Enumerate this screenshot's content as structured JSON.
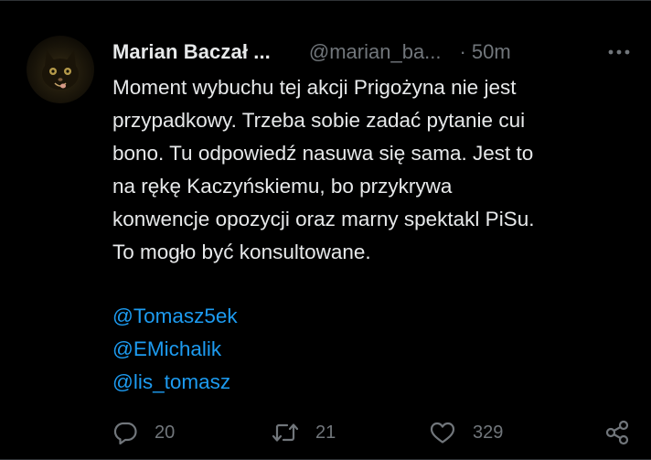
{
  "tweet": {
    "author": {
      "display_name": "Marian Baczał ...",
      "handle": "@marian_ba...",
      "avatar_icon": "avatar-cat-photo"
    },
    "separator": "·",
    "time": "50m",
    "more_icon": "more-horizontal-icon",
    "text_lines": [
      "Moment wybuchu tej akcji Prigożyna nie jest",
      "przypadkowy. Trzeba sobie zadać pytanie cui",
      "bono. Tu odpowiedź nasuwa się sama. Jest to",
      "na rękę Kaczyńskiemu, bo przykrywa",
      "konwencje opozycji oraz marny spektakl PiSu.",
      "To mogło być konsultowane."
    ],
    "mentions": [
      "@Tomasz5ek",
      "@EMichalik",
      "@lis_tomasz"
    ],
    "actions": {
      "reply": {
        "icon": "reply-bubble-icon",
        "count": "20"
      },
      "retweet": {
        "icon": "retweet-arrows-icon",
        "count": "21"
      },
      "like": {
        "icon": "heart-icon",
        "count": "329"
      },
      "share": {
        "icon": "share-nodes-icon"
      }
    }
  },
  "colors": {
    "background": "#000000",
    "text_primary": "#e7e9ea",
    "text_secondary": "#71767b",
    "link": "#1d9bf0",
    "border": "#2f3336"
  }
}
